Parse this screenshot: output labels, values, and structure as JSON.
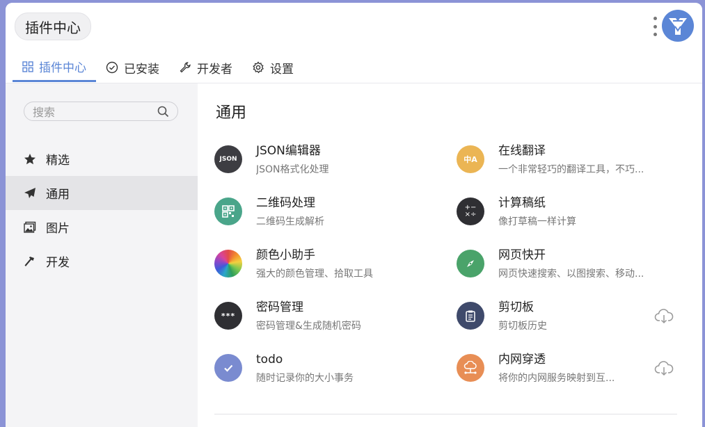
{
  "header": {
    "title": "插件中心",
    "tabs": [
      {
        "label": "插件中心",
        "icon": "grid-icon",
        "active": true
      },
      {
        "label": "已安装",
        "icon": "check-circle-icon"
      },
      {
        "label": "开发者",
        "icon": "wrench-icon"
      },
      {
        "label": "设置",
        "icon": "gear-icon"
      }
    ]
  },
  "sidebar": {
    "search_placeholder": "搜索",
    "items": [
      {
        "label": "精选",
        "icon": "star-icon"
      },
      {
        "label": "通用",
        "icon": "paper-plane-icon",
        "active": true
      },
      {
        "label": "图片",
        "icon": "image-icon"
      },
      {
        "label": "开发",
        "icon": "hammer-icon"
      }
    ]
  },
  "content": {
    "section_title": "通用",
    "plugins": [
      {
        "name": "JSON编辑器",
        "desc": "JSON格式化处理",
        "icon": "json-icon",
        "icon_text": "JSON",
        "color": "#3d3d42"
      },
      {
        "name": "在线翻译",
        "desc": "一个非常轻巧的翻译工具，不巧...",
        "icon": "translate-icon",
        "icon_text": "中A",
        "color": "#ebb554"
      },
      {
        "name": "二维码处理",
        "desc": "二维码生成解析",
        "icon": "qrcode-icon",
        "color": "#4aa58a"
      },
      {
        "name": "计算稿纸",
        "desc": "像打草稿一样计算",
        "icon": "calculator-icon",
        "icon_text": "+− ×÷",
        "color": "#2f2f33"
      },
      {
        "name": "颜色小助手",
        "desc": "强大的颜色管理、拾取工具",
        "icon": "color-wheel-icon",
        "color": "#e24a4a"
      },
      {
        "name": "网页快开",
        "desc": "网页快速搜索、以图搜索、移动...",
        "icon": "compass-icon",
        "color": "#4aa36a"
      },
      {
        "name": "密码管理",
        "desc": "密码管理&生成随机密码",
        "icon": "password-icon",
        "icon_text": "***",
        "color": "#2f2f33"
      },
      {
        "name": "剪切板",
        "desc": "剪切板历史",
        "icon": "clipboard-icon",
        "color": "#3f4a6b",
        "downloadable": true
      },
      {
        "name": "todo",
        "desc": "随时记录你的大小事务",
        "icon": "checkmark-icon",
        "color": "#7a8bd0"
      },
      {
        "name": "内网穿透",
        "desc": "将你的内网服务映射到互...",
        "icon": "cloud-network-icon",
        "color": "#e88e55",
        "downloadable": true
      }
    ]
  },
  "colors": {
    "accent": "#5b86d6",
    "sidebar_bg": "#f4f4f6",
    "sidebar_active": "#e4e4e7",
    "backdrop": "#8b93d6"
  }
}
